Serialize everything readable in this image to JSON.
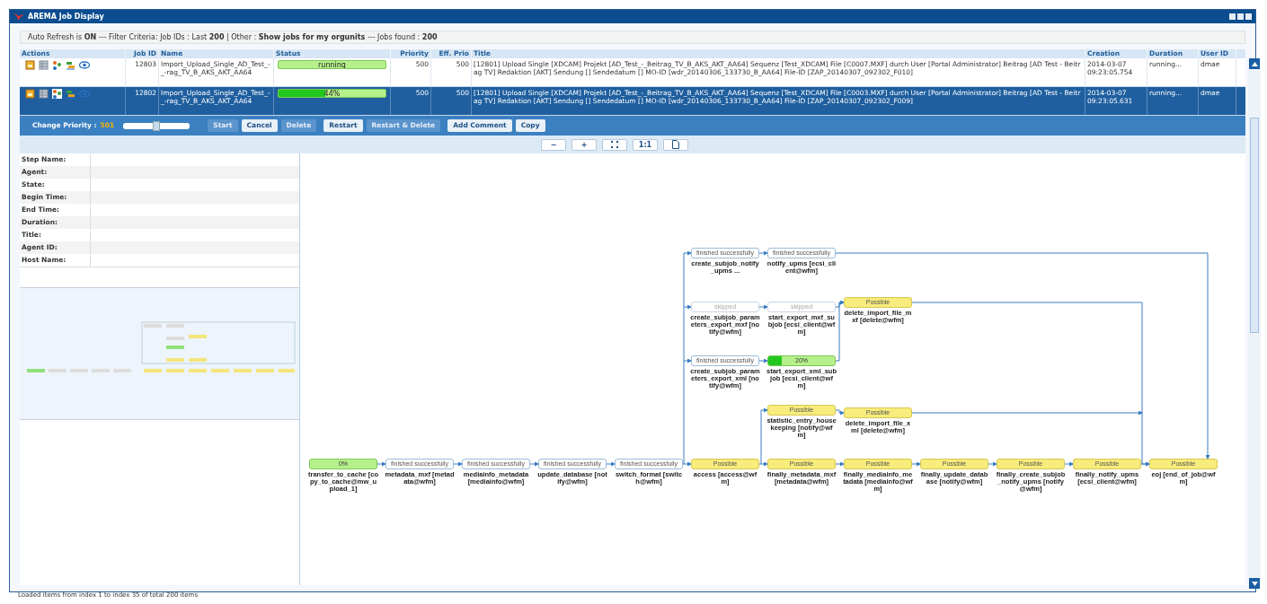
{
  "window": {
    "title": "AREMA Job Display"
  },
  "filter_bar": "Auto Refresh is **ON** --- Filter Criteria: Job IDs : Last **200** | Other : **Show jobs for my orgunits** --- Jobs found : **200**",
  "table": {
    "columns": [
      "Actions",
      "Job ID",
      "Name",
      "Status",
      "Priority",
      "Eff. Prio",
      "Title",
      "Creation",
      "Duration",
      "User ID"
    ],
    "rows": [
      {
        "selected": false,
        "job_id": "12803",
        "name": "Import_Upload_Single_AD_Test_-_-rag_TV_B_AKS_AKT_AA64",
        "status": "running",
        "level": 0,
        "priority": "500",
        "eff_prio": "500",
        "title": "[12801] Upload Single [XDCAM] Projekt [AD_Test_-_Beitrag_TV_B_AKS_AKT_AA64] Sequenz [Test_XDCAM] File [C0007.MXF] durch User [Portal Administrator] Beitrag [AD Test - Beitrag TV] Redaktion [AKT] Sendung [] Sendedatum [] MO-ID [wdr_20140306_133730_B_AA64] File-ID [ZAP_20140307_092302_F010]",
        "creation": "2014-03-07 09:23:05.754",
        "duration": "running...",
        "user_id": "dmae"
      },
      {
        "selected": true,
        "job_id": "12802",
        "name": "Import_Upload_Single_AD_Test_-_-rag_TV_B_AKS_AKT_AA64",
        "status": "44%",
        "level": 0.44,
        "priority": "500",
        "eff_prio": "500",
        "title": "[12801] Upload Single [XDCAM] Projekt [AD_Test_-_Beitrag_TV_B_AKS_AKT_AA64] Sequenz [Test_XDCAM] File [C0003.MXF] durch User [Portal Administrator] Beitrag [AD Test - Beitrag TV] Redaktion [AKT] Sendung [] Sendedatum [] MO-ID [wdr_20140306_133730_B_AA64] File-ID [ZAP_20140307_092302_F009]",
        "creation": "2014-03-07 09:23:05.631",
        "duration": "running...",
        "user_id": "dmae"
      }
    ]
  },
  "toolbar": {
    "priority_label": "Change Priority :",
    "priority_value": "501",
    "priority_slider": {
      "level": 0.5
    },
    "buttons": [
      {
        "label": "Start",
        "disabled": true
      },
      {
        "label": "Cancel",
        "disabled": false
      },
      {
        "label": "Delete",
        "disabled": true
      },
      {
        "label": "Restart",
        "disabled": false
      },
      {
        "label": "Restart & Delete",
        "disabled": true
      },
      {
        "label": "Add Comment",
        "disabled": false
      },
      {
        "label": "Copy",
        "disabled": false
      }
    ]
  },
  "zoom_toolbar": [
    {
      "kind": "text",
      "label": "−"
    },
    {
      "kind": "text",
      "label": "+"
    },
    {
      "kind": "fit"
    },
    {
      "kind": "text",
      "label": "1:1"
    },
    {
      "kind": "page"
    }
  ],
  "properties": [
    "Step Name:",
    "Agent:",
    "State:",
    "Begin Time:",
    "End Time:",
    "Duration:",
    "Title:",
    "Agent ID:",
    "Host Name:"
  ],
  "nodes": [
    {
      "kind": "done",
      "status": "finished successfully",
      "label": "create_subjob_notify_upms ..."
    },
    {
      "kind": "done",
      "status": "finished successfully",
      "label": "notify_upms [ecsi_client@wfm]"
    },
    {
      "kind": "skipped",
      "status": "skipped",
      "label": "create_subjob_parameters_export_mxf [notify@wfm]"
    },
    {
      "kind": "skipped",
      "status": "skipped",
      "label": "start_export_mxf_subjob [ecsi_client@wfm]"
    },
    {
      "kind": "pending",
      "status": "Possible",
      "label": "delete_import_file_mxf [delete@wfm]"
    },
    {
      "kind": "done",
      "status": "finished successfully",
      "label": "create_subjob_parameters_export_xml [notify@wfm]"
    },
    {
      "kind": "progress",
      "status": "20%",
      "level": 0.2,
      "label": "start_export_xml_subjob [ecsi_client@wfm]"
    },
    {
      "kind": "pending",
      "status": "Possible",
      "label": "statistic_entry_housekeeping [notify@wfm]"
    },
    {
      "kind": "pending",
      "status": "Possible",
      "label": "delete_import_file_xml [delete@wfm]"
    },
    {
      "kind": "progress",
      "status": "0%",
      "level": 0,
      "label": "transfer_to_cache [copy_to_cache@mw_upload_1]"
    },
    {
      "kind": "done",
      "status": "finished successfully",
      "label": "metadata_mxf [metadata@wfm]"
    },
    {
      "kind": "done",
      "status": "finished successfully",
      "label": "mediainfo_metadata [mediainfo@wfm]"
    },
    {
      "kind": "done",
      "status": "finished successfully",
      "label": "update_database [notify@wfm]"
    },
    {
      "kind": "done",
      "status": "finished successfully",
      "label": "switch_format [switch@wfm]"
    },
    {
      "kind": "pending",
      "status": "Possible",
      "label": "access [access@wfm]"
    },
    {
      "kind": "pending",
      "status": "Possible",
      "label": "finally_metadata_mxf [metadata@wfm]"
    },
    {
      "kind": "pending",
      "status": "Possible",
      "label": "finally_mediainfo_metadata [mediainfo@wfm]"
    },
    {
      "kind": "pending",
      "status": "Possible",
      "label": "finally_update_database [notify@wfm]"
    },
    {
      "kind": "pending",
      "status": "Possible",
      "label": "finally_create_subjob_notify_upms [notify@wfm]"
    },
    {
      "kind": "pending",
      "status": "Possible",
      "label": "finally_notify_upms [ecsi_client@wfm]"
    },
    {
      "kind": "pending",
      "status": "Possible",
      "label": "eoj [end_of_job@wfm]"
    }
  ],
  "status_bar": "Loaded items from index 1 to index 35 of total 200 items"
}
